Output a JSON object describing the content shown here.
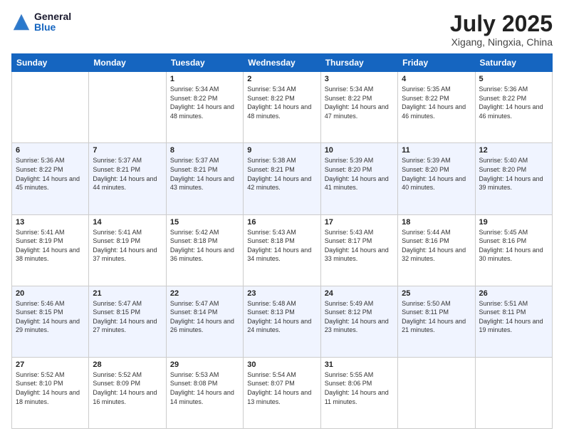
{
  "logo": {
    "general": "General",
    "blue": "Blue"
  },
  "header": {
    "title": "July 2025",
    "subtitle": "Xigang, Ningxia, China"
  },
  "days": [
    "Sunday",
    "Monday",
    "Tuesday",
    "Wednesday",
    "Thursday",
    "Friday",
    "Saturday"
  ],
  "weeks": [
    [
      {
        "date": "",
        "info": ""
      },
      {
        "date": "",
        "info": ""
      },
      {
        "date": "1",
        "info": "Sunrise: 5:34 AM\nSunset: 8:22 PM\nDaylight: 14 hours and 48 minutes."
      },
      {
        "date": "2",
        "info": "Sunrise: 5:34 AM\nSunset: 8:22 PM\nDaylight: 14 hours and 48 minutes."
      },
      {
        "date": "3",
        "info": "Sunrise: 5:34 AM\nSunset: 8:22 PM\nDaylight: 14 hours and 47 minutes."
      },
      {
        "date": "4",
        "info": "Sunrise: 5:35 AM\nSunset: 8:22 PM\nDaylight: 14 hours and 46 minutes."
      },
      {
        "date": "5",
        "info": "Sunrise: 5:36 AM\nSunset: 8:22 PM\nDaylight: 14 hours and 46 minutes."
      }
    ],
    [
      {
        "date": "6",
        "info": "Sunrise: 5:36 AM\nSunset: 8:22 PM\nDaylight: 14 hours and 45 minutes."
      },
      {
        "date": "7",
        "info": "Sunrise: 5:37 AM\nSunset: 8:21 PM\nDaylight: 14 hours and 44 minutes."
      },
      {
        "date": "8",
        "info": "Sunrise: 5:37 AM\nSunset: 8:21 PM\nDaylight: 14 hours and 43 minutes."
      },
      {
        "date": "9",
        "info": "Sunrise: 5:38 AM\nSunset: 8:21 PM\nDaylight: 14 hours and 42 minutes."
      },
      {
        "date": "10",
        "info": "Sunrise: 5:39 AM\nSunset: 8:20 PM\nDaylight: 14 hours and 41 minutes."
      },
      {
        "date": "11",
        "info": "Sunrise: 5:39 AM\nSunset: 8:20 PM\nDaylight: 14 hours and 40 minutes."
      },
      {
        "date": "12",
        "info": "Sunrise: 5:40 AM\nSunset: 8:20 PM\nDaylight: 14 hours and 39 minutes."
      }
    ],
    [
      {
        "date": "13",
        "info": "Sunrise: 5:41 AM\nSunset: 8:19 PM\nDaylight: 14 hours and 38 minutes."
      },
      {
        "date": "14",
        "info": "Sunrise: 5:41 AM\nSunset: 8:19 PM\nDaylight: 14 hours and 37 minutes."
      },
      {
        "date": "15",
        "info": "Sunrise: 5:42 AM\nSunset: 8:18 PM\nDaylight: 14 hours and 36 minutes."
      },
      {
        "date": "16",
        "info": "Sunrise: 5:43 AM\nSunset: 8:18 PM\nDaylight: 14 hours and 34 minutes."
      },
      {
        "date": "17",
        "info": "Sunrise: 5:43 AM\nSunset: 8:17 PM\nDaylight: 14 hours and 33 minutes."
      },
      {
        "date": "18",
        "info": "Sunrise: 5:44 AM\nSunset: 8:16 PM\nDaylight: 14 hours and 32 minutes."
      },
      {
        "date": "19",
        "info": "Sunrise: 5:45 AM\nSunset: 8:16 PM\nDaylight: 14 hours and 30 minutes."
      }
    ],
    [
      {
        "date": "20",
        "info": "Sunrise: 5:46 AM\nSunset: 8:15 PM\nDaylight: 14 hours and 29 minutes."
      },
      {
        "date": "21",
        "info": "Sunrise: 5:47 AM\nSunset: 8:15 PM\nDaylight: 14 hours and 27 minutes."
      },
      {
        "date": "22",
        "info": "Sunrise: 5:47 AM\nSunset: 8:14 PM\nDaylight: 14 hours and 26 minutes."
      },
      {
        "date": "23",
        "info": "Sunrise: 5:48 AM\nSunset: 8:13 PM\nDaylight: 14 hours and 24 minutes."
      },
      {
        "date": "24",
        "info": "Sunrise: 5:49 AM\nSunset: 8:12 PM\nDaylight: 14 hours and 23 minutes."
      },
      {
        "date": "25",
        "info": "Sunrise: 5:50 AM\nSunset: 8:11 PM\nDaylight: 14 hours and 21 minutes."
      },
      {
        "date": "26",
        "info": "Sunrise: 5:51 AM\nSunset: 8:11 PM\nDaylight: 14 hours and 19 minutes."
      }
    ],
    [
      {
        "date": "27",
        "info": "Sunrise: 5:52 AM\nSunset: 8:10 PM\nDaylight: 14 hours and 18 minutes."
      },
      {
        "date": "28",
        "info": "Sunrise: 5:52 AM\nSunset: 8:09 PM\nDaylight: 14 hours and 16 minutes."
      },
      {
        "date": "29",
        "info": "Sunrise: 5:53 AM\nSunset: 8:08 PM\nDaylight: 14 hours and 14 minutes."
      },
      {
        "date": "30",
        "info": "Sunrise: 5:54 AM\nSunset: 8:07 PM\nDaylight: 14 hours and 13 minutes."
      },
      {
        "date": "31",
        "info": "Sunrise: 5:55 AM\nSunset: 8:06 PM\nDaylight: 14 hours and 11 minutes."
      },
      {
        "date": "",
        "info": ""
      },
      {
        "date": "",
        "info": ""
      }
    ]
  ]
}
